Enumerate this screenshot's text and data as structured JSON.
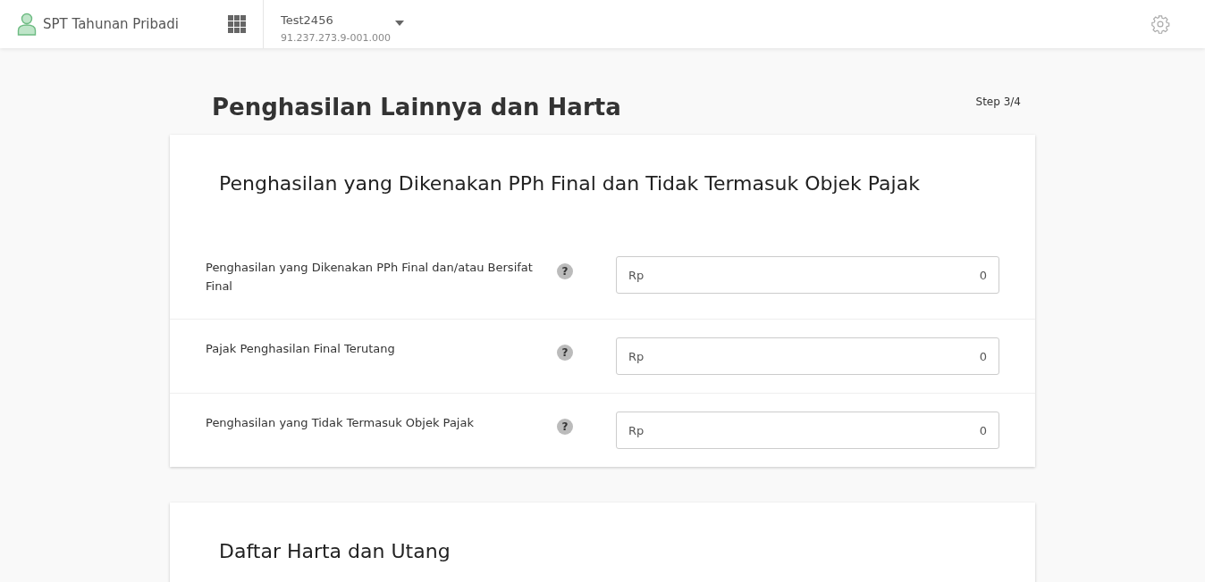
{
  "header": {
    "app_title": "SPT Tahunan Pribadi",
    "account": {
      "name": "Test2456",
      "npwp": "91.237.273.9-001.000"
    }
  },
  "page": {
    "title": "Penghasilan Lainnya dan Harta",
    "step": "Step 3/4"
  },
  "sections": [
    {
      "title": "Penghasilan yang Dikenakan PPh Final dan Tidak Termasuk Objek Pajak",
      "rows": [
        {
          "label": "Penghasilan yang Dikenakan PPh Final dan/atau Bersifat Final",
          "help": "?",
          "prefix": "Rp",
          "value": "0"
        },
        {
          "label": "Pajak Penghasilan Final Terutang",
          "help": "?",
          "prefix": "Rp",
          "value": "0"
        },
        {
          "label": "Penghasilan yang Tidak Termasuk Objek Pajak",
          "help": "?",
          "prefix": "Rp",
          "value": "0"
        }
      ]
    },
    {
      "title": "Daftar Harta dan Utang"
    }
  ]
}
